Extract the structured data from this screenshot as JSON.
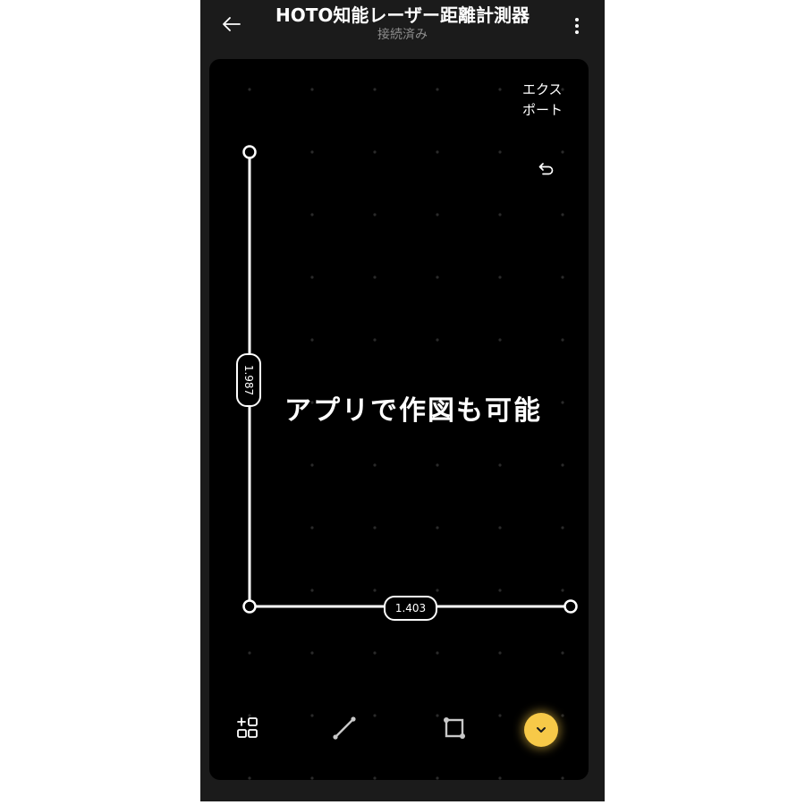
{
  "header": {
    "title": "HOTO知能レーザー距離計測器",
    "subtitle": "接続済み",
    "back_icon": "arrow-left-icon",
    "menu_icon": "more-vertical-icon"
  },
  "canvas": {
    "export_label": "エクス\nポート",
    "undo_icon": "undo-icon",
    "overlay_text": "アプリで作図も可能",
    "measurements": [
      {
        "id": "vertical",
        "value": "1.987"
      },
      {
        "id": "horizontal",
        "value": "1.403"
      }
    ]
  },
  "toolbar": {
    "items": [
      {
        "icon": "add-shape-icon"
      },
      {
        "icon": "line-tool-icon"
      },
      {
        "icon": "rectangle-tool-icon"
      },
      {
        "icon": "chevron-down-icon"
      }
    ]
  },
  "colors": {
    "background": "#1b1b1b",
    "canvas": "#000000",
    "accent": "#f7c948",
    "text_primary": "#ffffff",
    "text_secondary": "#8e8e8e"
  }
}
